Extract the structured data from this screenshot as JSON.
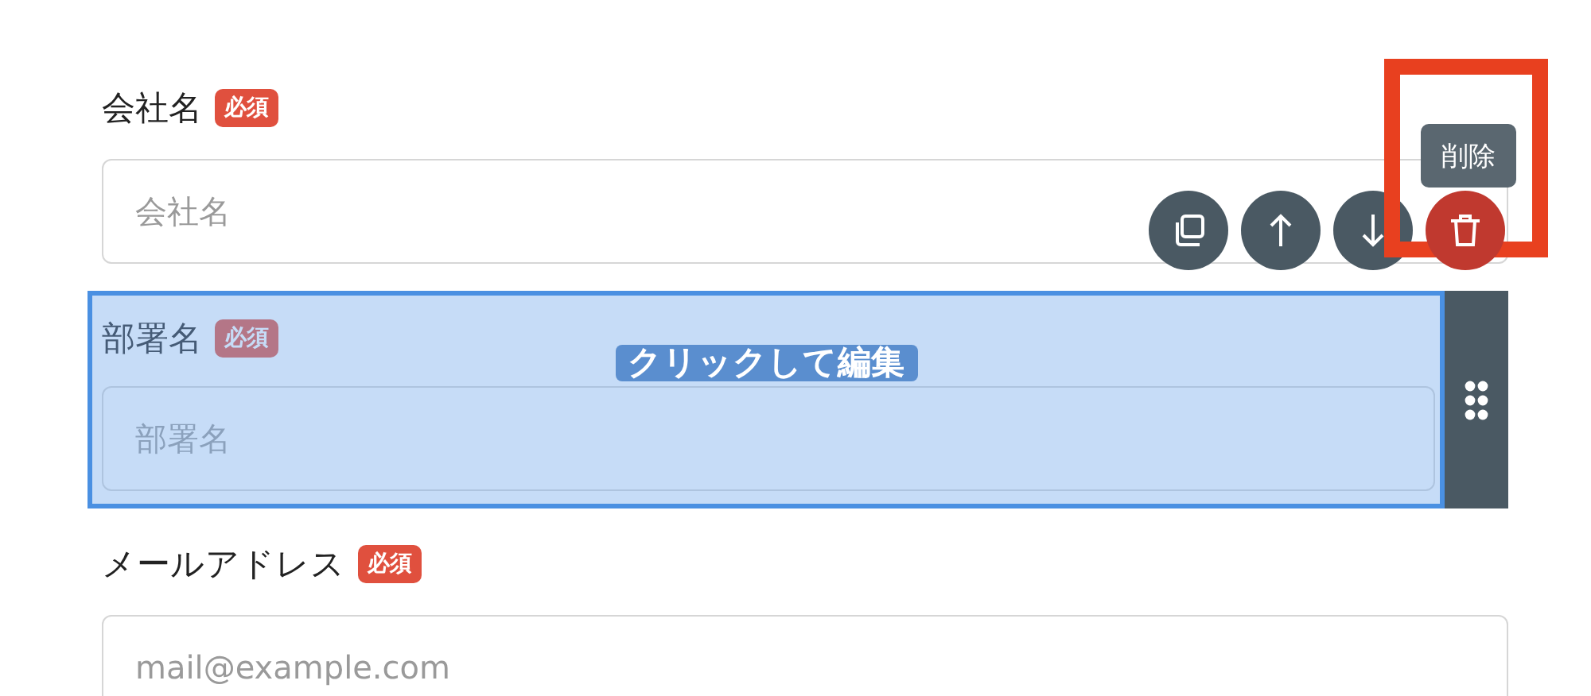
{
  "fields": [
    {
      "label": "会社名",
      "badge": "必須",
      "placeholder": "会社名",
      "selected": false
    },
    {
      "label": "部署名",
      "badge": "必須",
      "placeholder": "部署名",
      "selected": true
    },
    {
      "label": "メールアドレス",
      "badge": "必須",
      "placeholder": "mail@example.com",
      "selected": false
    }
  ],
  "overlay_text": "クリックして編集",
  "toolbar": [
    {
      "kind": "copy",
      "highlighted": false
    },
    {
      "kind": "up",
      "highlighted": false
    },
    {
      "kind": "down",
      "highlighted": false
    },
    {
      "kind": "delete",
      "highlighted": true,
      "tooltip": "削除"
    }
  ]
}
